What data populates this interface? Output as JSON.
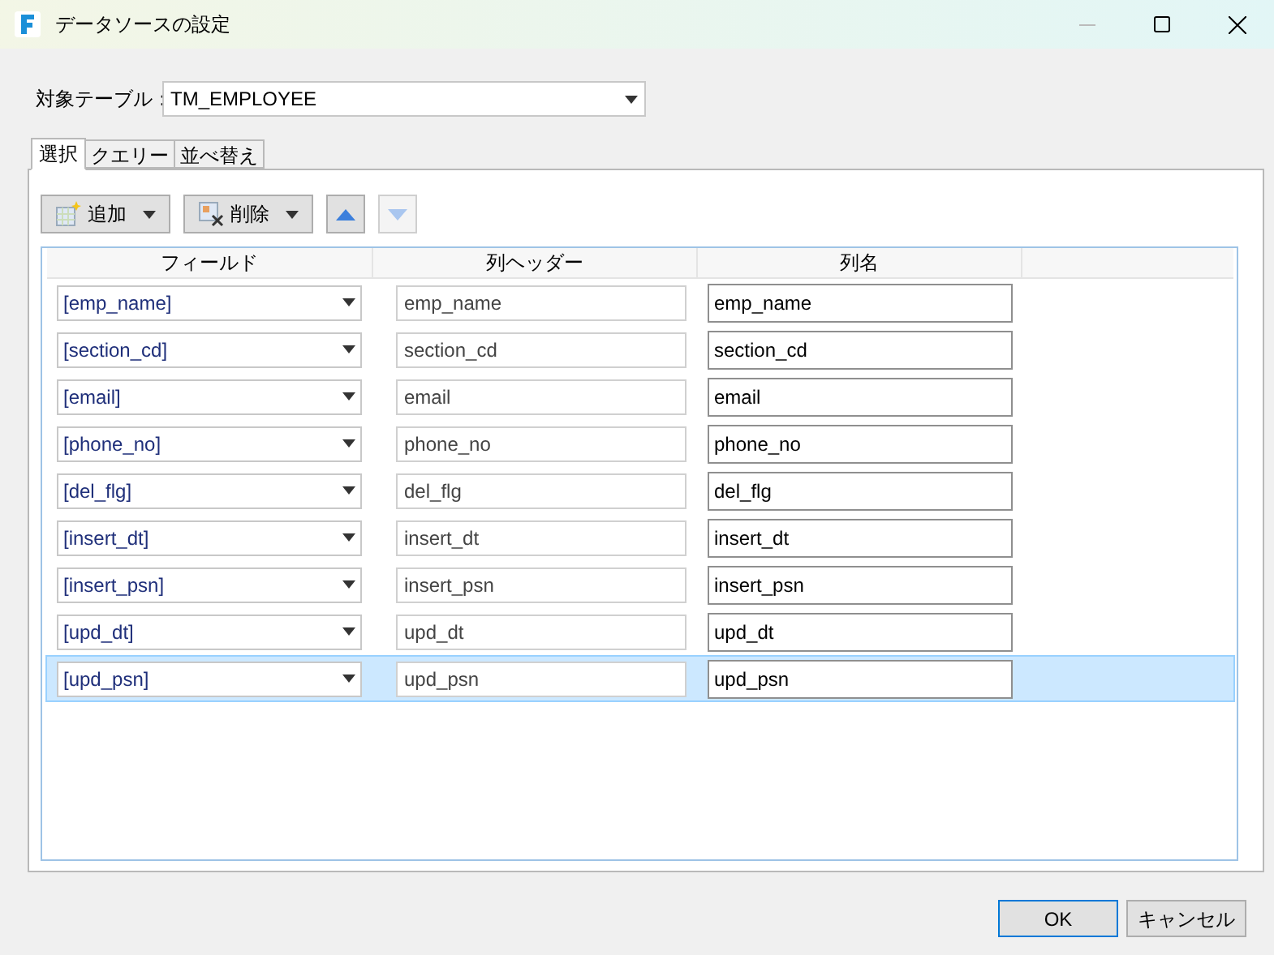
{
  "window": {
    "title": "データソースの設定",
    "minimize_disabled": true
  },
  "target_table": {
    "label": "対象テーブル：",
    "value": "TM_EMPLOYEE"
  },
  "tabs": [
    {
      "label": "選択",
      "selected": true
    },
    {
      "label": "クエリー",
      "selected": false
    },
    {
      "label": "並べ替え",
      "selected": false
    }
  ],
  "toolbar": {
    "add": "追加",
    "delete": "削除",
    "move_up_disabled": false,
    "move_down_disabled": true
  },
  "table": {
    "columns": [
      "フィールド",
      "列ヘッダー",
      "列名"
    ],
    "rows": [
      {
        "field": "[emp_name]",
        "header": "emp_name",
        "name": "emp_name",
        "selected": false
      },
      {
        "field": "[section_cd]",
        "header": "section_cd",
        "name": "section_cd",
        "selected": false
      },
      {
        "field": "[email]",
        "header": "email",
        "name": "email",
        "selected": false
      },
      {
        "field": "[phone_no]",
        "header": "phone_no",
        "name": "phone_no",
        "selected": false
      },
      {
        "field": "[del_flg]",
        "header": "del_flg",
        "name": "del_flg",
        "selected": false
      },
      {
        "field": "[insert_dt]",
        "header": "insert_dt",
        "name": "insert_dt",
        "selected": false
      },
      {
        "field": "[insert_psn]",
        "header": "insert_psn",
        "name": "insert_psn",
        "selected": false
      },
      {
        "field": "[upd_dt]",
        "header": "upd_dt",
        "name": "upd_dt",
        "selected": false
      },
      {
        "field": "[upd_psn]",
        "header": "upd_psn",
        "name": "upd_psn",
        "selected": true
      }
    ]
  },
  "buttons": [
    "OK",
    "キャンセル"
  ]
}
